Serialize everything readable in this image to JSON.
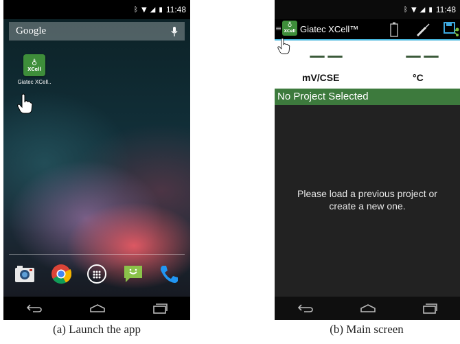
{
  "phone_a": {
    "status_time": "11:48",
    "search_label": "Google",
    "app": {
      "icon_text": "XCell",
      "label": "Giatec XCell.."
    },
    "dock": [
      "camera-app-icon",
      "chrome-app-icon",
      "app-drawer-icon",
      "messaging-app-icon",
      "phone-app-icon"
    ],
    "caption": "(a) Launch the app"
  },
  "phone_b": {
    "status_time": "11:48",
    "app_icon_text": "XCell",
    "app_title": "Giatec XCell™",
    "readings": [
      {
        "value": "——",
        "unit": "mV/CSE"
      },
      {
        "value": "——",
        "unit": "°C"
      }
    ],
    "project_status": "No Project Selected",
    "message_line1": "Please load a previous project or",
    "message_line2": "create a new one.",
    "caption": "(b) Main screen"
  },
  "colors": {
    "accent_green": "#3d7a3d",
    "cyan": "#47b6dd",
    "content_bg": "#222222"
  }
}
